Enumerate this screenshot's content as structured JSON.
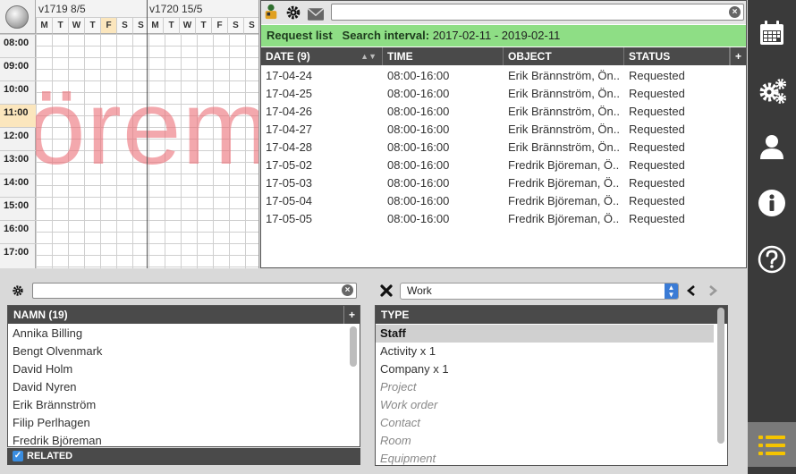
{
  "calendar": {
    "weeks": [
      {
        "label": "v1719 8/5",
        "days": [
          "M",
          "T",
          "W",
          "T",
          "F",
          "S",
          "S"
        ],
        "today_index": 4
      },
      {
        "label": "v1720 15/5",
        "days": [
          "M",
          "T",
          "W",
          "T",
          "F",
          "S",
          "S"
        ],
        "today_index": -1
      }
    ],
    "hours": [
      "08:00",
      "09:00",
      "10:00",
      "11:00",
      "12:00",
      "13:00",
      "14:00",
      "15:00",
      "16:00",
      "17:00"
    ],
    "current_hour_index": 3,
    "watermark": "örem"
  },
  "request_panel": {
    "search_value": "",
    "title": "Request list",
    "interval_label": "Search interval:",
    "interval_value": "2017-02-11 - 2019-02-11",
    "columns": [
      "DATE (9)",
      "TIME",
      "OBJECT",
      "STATUS"
    ],
    "add_label": "+",
    "rows": [
      {
        "date": "17-04-24",
        "time": "08:00-16:00",
        "object": "Erik Brännström, Ön...",
        "status": "Requested"
      },
      {
        "date": "17-04-25",
        "time": "08:00-16:00",
        "object": "Erik Brännström, Ön...",
        "status": "Requested"
      },
      {
        "date": "17-04-26",
        "time": "08:00-16:00",
        "object": "Erik Brännström, Ön...",
        "status": "Requested"
      },
      {
        "date": "17-04-27",
        "time": "08:00-16:00",
        "object": "Erik Brännström, Ön...",
        "status": "Requested"
      },
      {
        "date": "17-04-28",
        "time": "08:00-16:00",
        "object": "Erik Brännström, Ön...",
        "status": "Requested"
      },
      {
        "date": "17-05-02",
        "time": "08:00-16:00",
        "object": "Fredrik Björeman, Ö...",
        "status": "Requested"
      },
      {
        "date": "17-05-03",
        "time": "08:00-16:00",
        "object": "Fredrik Björeman, Ö...",
        "status": "Requested"
      },
      {
        "date": "17-05-04",
        "time": "08:00-16:00",
        "object": "Fredrik Björeman, Ö...",
        "status": "Requested"
      },
      {
        "date": "17-05-05",
        "time": "08:00-16:00",
        "object": "Fredrik Björeman, Ö...",
        "status": "Requested"
      }
    ]
  },
  "names_panel": {
    "search_value": "",
    "header": "NAMN (19)",
    "add_label": "+",
    "items": [
      "Annika Billing",
      "Bengt Olvenmark",
      "David Holm",
      "David Nyren",
      "Erik Brännström",
      "Filip Perlhagen",
      "Fredrik Björeman"
    ],
    "related_label": "RELATED",
    "related_checked": true
  },
  "type_panel": {
    "selected_value": "Work",
    "header": "TYPE",
    "items": [
      {
        "label": "Staff",
        "style": "selected"
      },
      {
        "label": "Activity x 1",
        "style": "normal"
      },
      {
        "label": "Company x 1",
        "style": "normal"
      },
      {
        "label": "Project",
        "style": "italic"
      },
      {
        "label": "Work order",
        "style": "italic"
      },
      {
        "label": "Contact",
        "style": "italic"
      },
      {
        "label": "Room",
        "style": "italic"
      },
      {
        "label": "Equipment",
        "style": "italic"
      }
    ]
  },
  "sidebar": {
    "items": [
      "calendar-icon",
      "gears-icon",
      "user-icon",
      "info-icon",
      "help-icon",
      "list-icon"
    ],
    "active": "list-icon"
  },
  "colors": {
    "accent_green": "#8ede85",
    "header_dark": "#4a4a4a",
    "sidebar": "#3a3a3a",
    "today_highlight": "#fbe6bd",
    "watermark": "#ec6f78"
  }
}
